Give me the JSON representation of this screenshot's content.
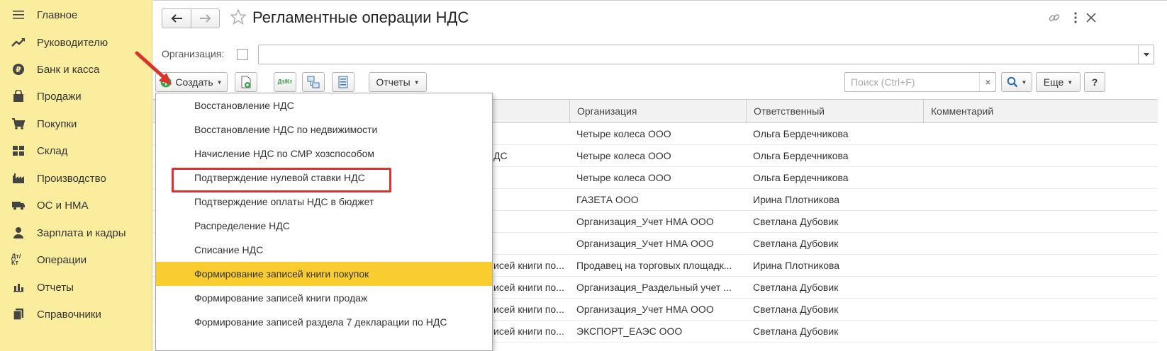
{
  "sidebar": {
    "items": [
      {
        "label": "Главное",
        "icon": "menu-icon"
      },
      {
        "label": "Руководителю",
        "icon": "trend-up-icon"
      },
      {
        "label": "Банк и касса",
        "icon": "coin-icon"
      },
      {
        "label": "Продажи",
        "icon": "bag-icon"
      },
      {
        "label": "Покупки",
        "icon": "cart-icon"
      },
      {
        "label": "Склад",
        "icon": "warehouse-icon"
      },
      {
        "label": "Производство",
        "icon": "factory-icon"
      },
      {
        "label": "ОС и НМА",
        "icon": "truck-icon"
      },
      {
        "label": "Зарплата и кадры",
        "icon": "person-icon"
      },
      {
        "label": "Операции",
        "icon": "debit-credit-icon",
        "glyph": "Дт/Кт"
      },
      {
        "label": "Отчеты",
        "icon": "bar-chart-icon"
      },
      {
        "label": "Справочники",
        "icon": "books-icon"
      }
    ]
  },
  "header": {
    "title": "Регламентные операции НДС"
  },
  "filter": {
    "org_label": "Организация:",
    "org_value": ""
  },
  "toolbar": {
    "create_label": "Создать",
    "dtkt_glyph": "Дт/Кт",
    "reports_label": "Отчеты",
    "search_placeholder": "Поиск (Ctrl+F)",
    "clear_glyph": "×",
    "more_label": "Еще",
    "help_label": "?"
  },
  "table": {
    "columns": [
      "Организация",
      "Ответственный",
      "Комментарий"
    ],
    "rows": [
      {
        "peek": "",
        "org": "Четыре колеса ООО",
        "resp": "Ольга Бердечникова",
        "comment": ""
      },
      {
        "peek": "ДС",
        "org": "Четыре колеса ООО",
        "resp": "Ольга Бердечникова",
        "comment": ""
      },
      {
        "peek": "",
        "org": "Четыре колеса ООО",
        "resp": "Ольга Бердечникова",
        "comment": ""
      },
      {
        "peek": "",
        "org": "ГАЗЕТА ООО",
        "resp": "Ирина Плотникова",
        "comment": ""
      },
      {
        "peek": "",
        "org": "Организация_Учет НМА ООО",
        "resp": "Светлана Дубовик",
        "comment": ""
      },
      {
        "peek": "",
        "org": "Организация_Учет НМА ООО",
        "resp": "Светлана Дубовик",
        "comment": ""
      },
      {
        "peek": "исей книги по...",
        "org": "Продавец на торговых площадк...",
        "resp": "Ирина Плотникова",
        "comment": ""
      },
      {
        "peek": "исей книги по...",
        "org": "Организация_Раздельный учет ...",
        "resp": "Светлана Дубовик",
        "comment": ""
      },
      {
        "peek": "исей книги по...",
        "org": "Организация_Учет НМА ООО",
        "resp": "Светлана Дубовик",
        "comment": ""
      },
      {
        "peek": "исей книги по...",
        "org": "ЭКСПОРТ_ЕАЭС ООО",
        "resp": "Светлана Дубовик",
        "comment": ""
      }
    ]
  },
  "create_menu": {
    "items": [
      "Восстановление НДС",
      "Восстановление НДС по недвижимости",
      "Начисление НДС по СМР хозспособом",
      "Подтверждение нулевой ставки НДС",
      "Подтверждение оплаты НДС в бюджет",
      "Распределение НДС",
      "Списание НДС",
      "Формирование записей книги покупок",
      "Формирование записей книги продаж",
      "Формирование записей раздела 7 декларации по НДС"
    ],
    "selected_index": 7
  },
  "colors": {
    "sidebar_bg": "#fbed9e",
    "selected_bg": "#f9cc2f",
    "highlight_border": "#d9342b",
    "arrow": "#d9342b",
    "create_icon": "#3aa84a"
  }
}
